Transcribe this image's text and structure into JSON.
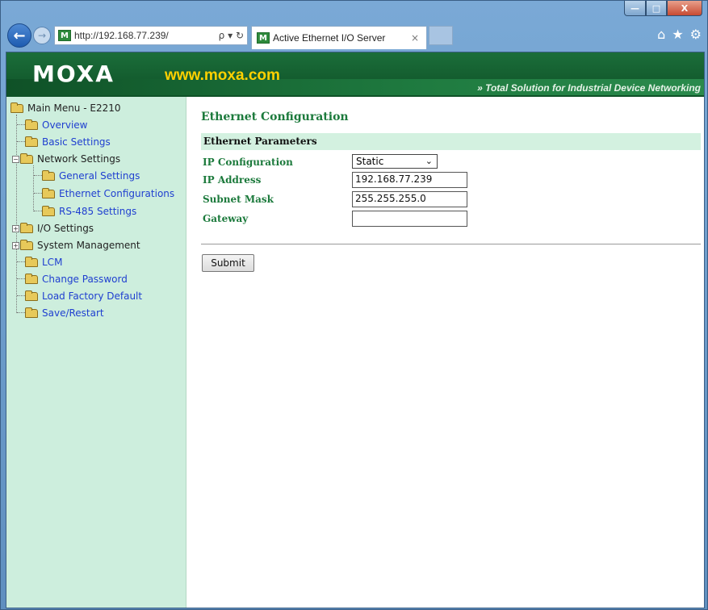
{
  "browser": {
    "url": "http://192.168.77.239/",
    "address_tools": "ρ ▾ ↻",
    "tab_title": "Active Ethernet I/O Server",
    "tab_close": "×",
    "favicon_letter": "M",
    "window_controls": {
      "minimize": "—",
      "maximize": "□",
      "close": "X"
    },
    "icons": [
      "home-icon",
      "favorites-star-icon",
      "settings-gear-icon"
    ]
  },
  "banner": {
    "logo": "MOXA",
    "logo_url": "www.moxa.com",
    "tagline": "» Total Solution for Industrial Device Networking"
  },
  "sidebar": {
    "root": "Main Menu - E2210",
    "items": [
      {
        "label": "Overview"
      },
      {
        "label": "Basic Settings"
      },
      {
        "label": "Network Settings"
      },
      {
        "label": "General Settings"
      },
      {
        "label": "Ethernet Configurations"
      },
      {
        "label": "RS-485 Settings"
      },
      {
        "label": "I/O Settings"
      },
      {
        "label": "System Management"
      },
      {
        "label": "LCM"
      },
      {
        "label": "Change Password"
      },
      {
        "label": "Load Factory Default"
      },
      {
        "label": "Save/Restart"
      }
    ]
  },
  "main": {
    "title": "Ethernet Configuration",
    "section": "Ethernet Parameters",
    "fields": {
      "ip_config": {
        "label": "IP Configuration",
        "value": "Static"
      },
      "ip_address": {
        "label": "IP Address",
        "value": "192.168.77.239"
      },
      "subnet_mask": {
        "label": "Subnet Mask",
        "value": "255.255.255.0"
      },
      "gateway": {
        "label": "Gateway",
        "value": ""
      }
    },
    "submit_label": "Submit"
  },
  "colors": {
    "banner_green": "#1b6e3a",
    "sidebar_bg": "#cdeedd",
    "heading_green": "#1c7a3c",
    "link_blue": "#1f3fd0",
    "logo_url_yellow": "#ffd100"
  }
}
